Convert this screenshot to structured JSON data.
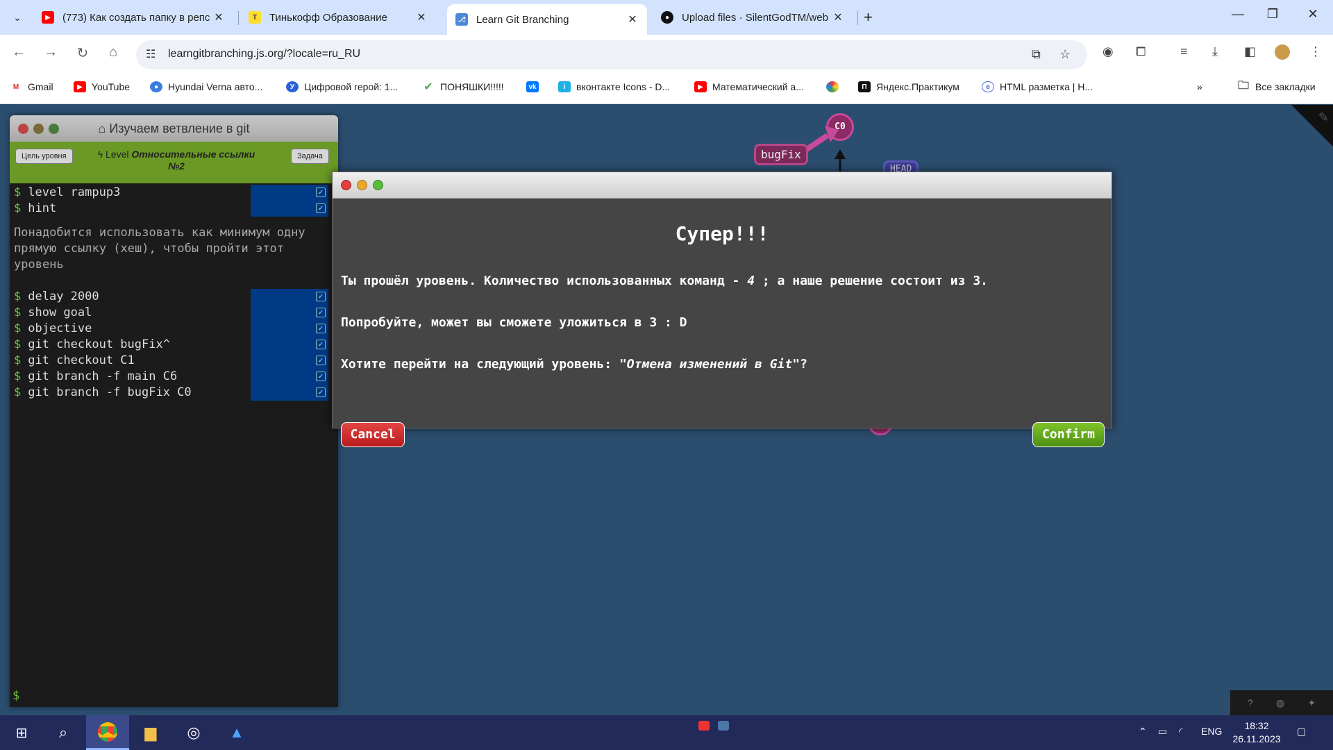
{
  "tabs": [
    {
      "title": "(773) Как создать папку в репс",
      "icon": "youtube-icon",
      "color": "#ff0000"
    },
    {
      "title": "Тинькофф Образование",
      "icon": "tinkoff-icon",
      "color": "#ffdd2d"
    },
    {
      "title": "Learn Git Branching",
      "icon": "git-branching-icon",
      "color": "#4a8ad8"
    },
    {
      "title": "Upload files · SilentGodTM/web",
      "icon": "github-icon",
      "color": "#111111"
    }
  ],
  "address": {
    "url": "learngitbranching.js.org/?locale=ru_RU"
  },
  "bookmarks": [
    {
      "label": "Gmail",
      "icon": "gmail-icon"
    },
    {
      "label": "YouTube",
      "icon": "youtube-icon"
    },
    {
      "label": "Hyundai Verna авто...",
      "icon": "hyundai-icon"
    },
    {
      "label": "Цифровой герой: 1...",
      "icon": "digital-hero-icon"
    },
    {
      "label": "ПОНЯШКИ!!!!!",
      "icon": "checkmark-icon"
    },
    {
      "label": "",
      "icon": "vk-icon"
    },
    {
      "label": "вконтакте Icons - D...",
      "icon": "icons8-icon"
    },
    {
      "label": "Математический а...",
      "icon": "youtube-icon"
    },
    {
      "label": "",
      "icon": "color-circle-icon"
    },
    {
      "label": "Яндекс.Практикум",
      "icon": "yandex-practicum-icon"
    },
    {
      "label": "HTML разметка | Н...",
      "icon": "html-icon"
    }
  ],
  "bookmarks_all": "Все закладки",
  "terminal": {
    "title": "Изучаем ветвление в git",
    "goal_button": "Цель уровня",
    "task_button": "Задача",
    "level_prefix": "Level",
    "level_name": "Относительные ссылки №2",
    "commands_top": [
      "level rampup3",
      "hint"
    ],
    "hint": "Понадобится использовать как минимум одну прямую ссылку (хеш), чтобы пройти этот уровень",
    "commands_bottom": [
      "delay 2000",
      "show goal",
      "objective",
      "git checkout bugFix^",
      "git checkout C1",
      "git branch -f main C6",
      "git branch -f bugFix C0"
    ],
    "prompt": "$"
  },
  "graph": {
    "node_c0": "C0",
    "branch_bugfix": "bugFix",
    "head": "HEAD"
  },
  "dialog": {
    "heading": "Супер!!!",
    "line1_a": "Ты прошёл уровень. Количество использованных команд - ",
    "line1_num": "4",
    "line1_b": " ; а наше решение состоит из 3.",
    "line2": "Попробуйте, может вы сможете уложиться в 3 : D",
    "line3_a": "Хотите перейти на следующий уровень: ",
    "line3_level": "\"Отмена изменений в Git\"",
    "line3_b": "?",
    "cancel": "Cancel",
    "confirm": "Confirm"
  },
  "taskbar": {
    "lang": "ENG",
    "time": "18:32",
    "date": "26.11.2023"
  }
}
